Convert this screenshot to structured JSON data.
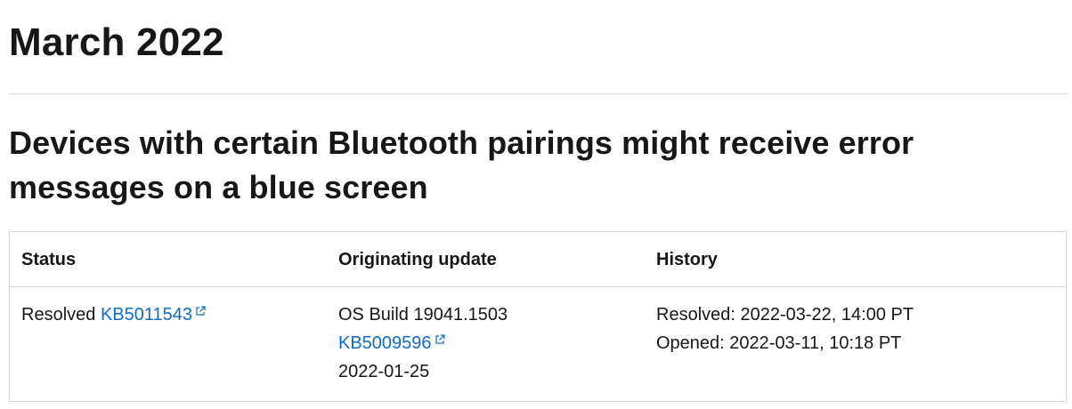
{
  "page": {
    "month_heading": "March 2022"
  },
  "issue": {
    "title": "Devices with certain Bluetooth pairings might receive error messages on a blue screen"
  },
  "table": {
    "headers": {
      "status": "Status",
      "originating_update": "Originating update",
      "history": "History"
    },
    "row": {
      "status_text": "Resolved",
      "status_kb": "KB5011543",
      "os_build": "OS Build 19041.1503",
      "origin_kb": "KB5009596",
      "origin_date": "2022-01-25",
      "history_resolved": "Resolved: 2022-03-22, 14:00 PT",
      "history_opened": "Opened: 2022-03-11, 10:18 PT"
    }
  },
  "colors": {
    "link": "#0e6dc4",
    "text": "#171717",
    "border": "#d7d7d7"
  },
  "icons": {
    "external_link": "external-link-icon"
  }
}
